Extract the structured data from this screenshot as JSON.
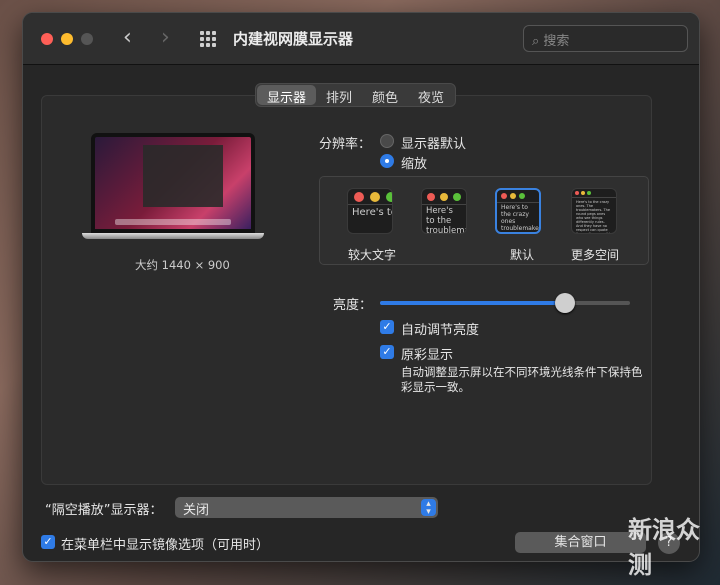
{
  "window": {
    "title": "内建视网膜显示器",
    "search_placeholder": "搜索"
  },
  "tabs": [
    {
      "label": "显示器",
      "selected": true
    },
    {
      "label": "排列"
    },
    {
      "label": "颜色"
    },
    {
      "label": "夜览"
    }
  ],
  "display": {
    "resolution_summary": "大约 1440 × 900"
  },
  "resolution": {
    "label": "分辨率：",
    "options": [
      {
        "label": "显示器默认",
        "selected": false
      },
      {
        "label": "缩放",
        "selected": true
      }
    ]
  },
  "scaling": {
    "options": [
      {
        "label": "较大文字",
        "preview": "Here's to the troublemakers"
      },
      {
        "label": "",
        "preview": "Here's to the troublemakers, ones who"
      },
      {
        "label": "默认",
        "preview": "Here's to the crazy ones troublemakers. The ones who see things rules. And they",
        "selected": true
      },
      {
        "label": "更多空间",
        "preview": "Here's to the crazy ones. The troublemakers. The round pegs ones who see things differently rules. And they have no respect can quote them, disagree with them. About the only thing Because they change things"
      }
    ]
  },
  "brightness": {
    "label": "亮度：",
    "value": 0.74
  },
  "auto_brightness": {
    "label": "自动调节亮度",
    "checked": true
  },
  "true_tone": {
    "label": "原彩显示",
    "checked": true,
    "description": "自动调整显示屏以在不同环境光线条件下保持色彩显示一致。"
  },
  "airplay": {
    "label": "“隔空播放”显示器：",
    "value": "关闭"
  },
  "mirror_option": {
    "label": "在菜单栏中显示镜像选项（可用时）",
    "checked": true
  },
  "gather_windows": "集合窗口",
  "help": "?",
  "watermark": "新浪众测"
}
